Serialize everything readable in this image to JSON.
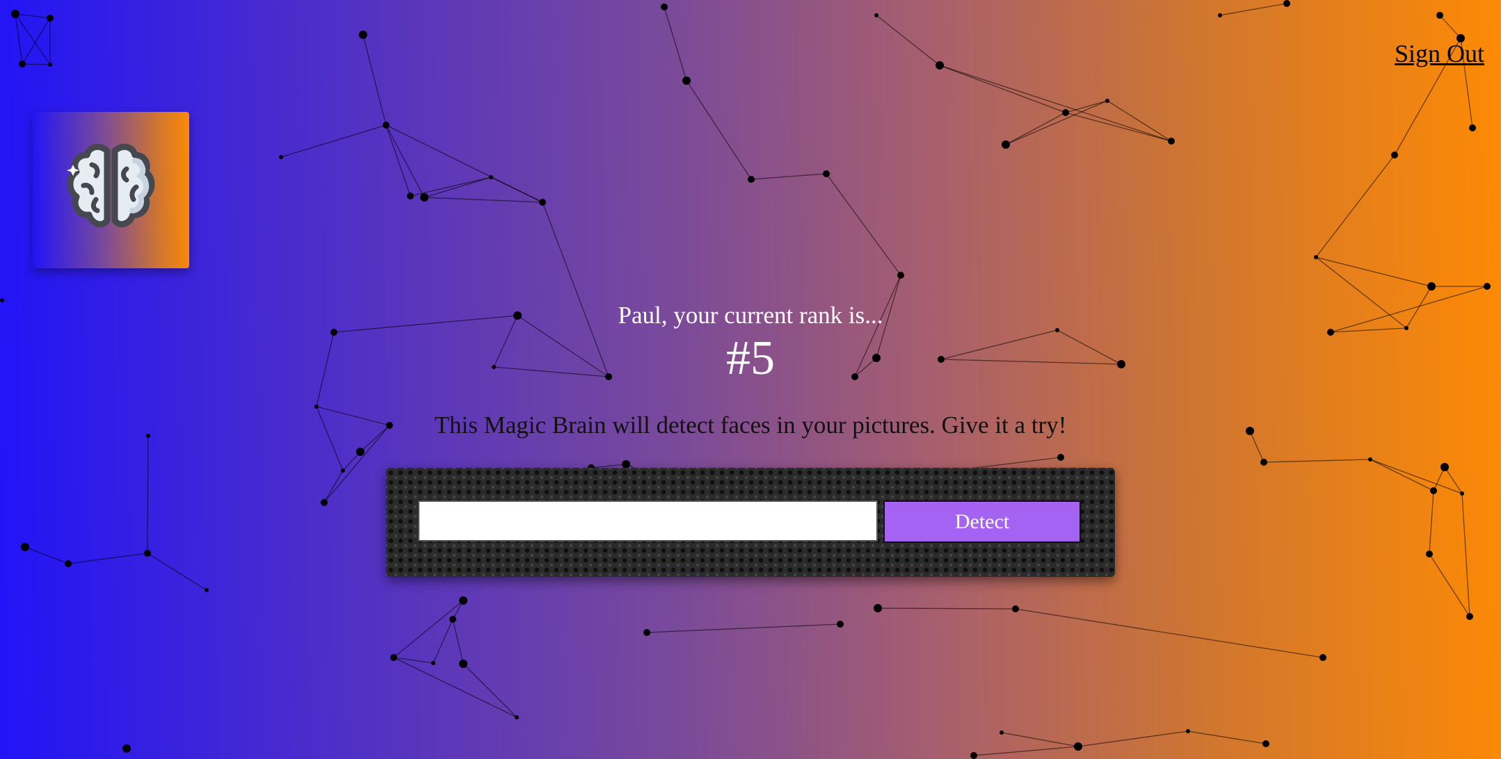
{
  "nav": {
    "signout_label": "Sign Out"
  },
  "logo": {
    "icon": "brain-icon"
  },
  "rank": {
    "message": "Paul, your current rank is...",
    "value": "#5"
  },
  "tagline": "This Magic Brain will detect faces in your pictures. Give it a try!",
  "form": {
    "input_value": "",
    "input_placeholder": "",
    "button_label": "Detect"
  },
  "colors": {
    "gradient_start": "#2114f7",
    "gradient_end": "#fd8a05",
    "button": "#a463f2",
    "panel": "#2b2b2b"
  }
}
